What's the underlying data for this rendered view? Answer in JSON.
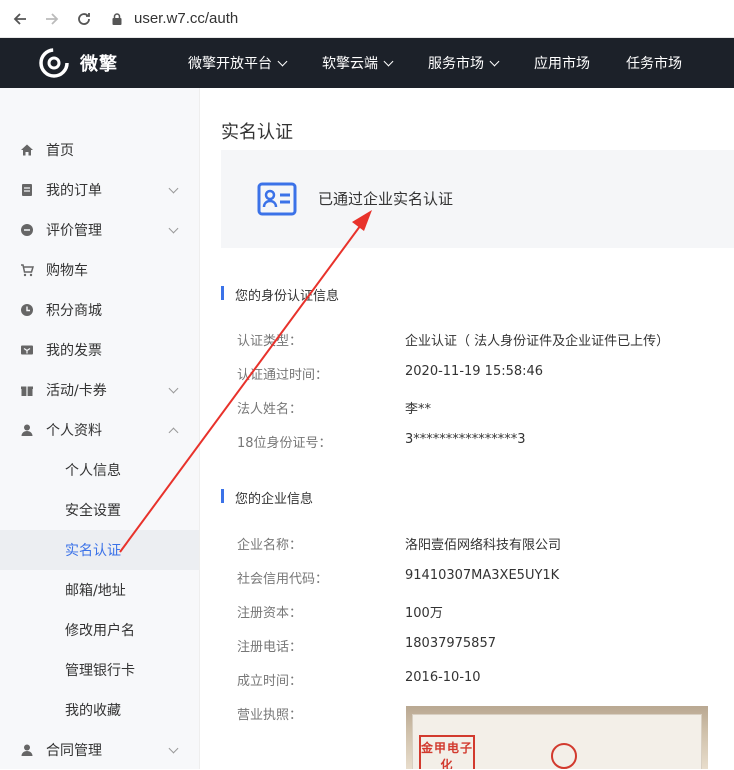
{
  "browser": {
    "url": "user.w7.cc/auth"
  },
  "topnav": {
    "logo_text": "微擎",
    "items": [
      {
        "label": "微擎开放平台",
        "dropdown": true
      },
      {
        "label": "软擎云端",
        "dropdown": true
      },
      {
        "label": "服务市场",
        "dropdown": true
      },
      {
        "label": "应用市场",
        "dropdown": false
      },
      {
        "label": "任务市场",
        "dropdown": false
      }
    ]
  },
  "sidebar": {
    "items": [
      {
        "label": "首页",
        "icon": "home-icon"
      },
      {
        "label": "我的订单",
        "icon": "order-icon",
        "expandable": true
      },
      {
        "label": "评价管理",
        "icon": "review-icon",
        "expandable": true
      },
      {
        "label": "购物车",
        "icon": "cart-icon"
      },
      {
        "label": "积分商城",
        "icon": "points-icon"
      },
      {
        "label": "我的发票",
        "icon": "invoice-icon"
      },
      {
        "label": "活动/卡券",
        "icon": "gift-icon",
        "expandable": true
      },
      {
        "label": "个人资料",
        "icon": "user-icon",
        "expanded": true
      }
    ],
    "sub_items": [
      {
        "label": "个人信息"
      },
      {
        "label": "安全设置"
      },
      {
        "label": "实名认证",
        "active": true
      },
      {
        "label": "邮箱/地址"
      },
      {
        "label": "修改用户名"
      },
      {
        "label": "管理银行卡"
      },
      {
        "label": "我的收藏"
      }
    ],
    "bottom_item": {
      "label": "合同管理",
      "icon": "contract-icon"
    }
  },
  "main": {
    "title": "实名认证",
    "status": "已通过企业实名认证",
    "identity_section": {
      "title": "您的身份认证信息",
      "rows": [
        {
          "label": "认证类型：",
          "value": "企业认证（ 法人身份证件及企业证件已上传）"
        },
        {
          "label": "认证通过时间：",
          "value": "2020-11-19 15:58:46"
        },
        {
          "label": "法人姓名：",
          "value": "李**"
        },
        {
          "label": "18位身份证号：",
          "value": "3****************3"
        }
      ]
    },
    "company_section": {
      "title": "您的企业信息",
      "rows": [
        {
          "label": "企业名称：",
          "value": "洛阳壹佰网络科技有限公司"
        },
        {
          "label": "社会信用代码：",
          "value": "91410307MA3XE5UY1K"
        },
        {
          "label": "注册资本：",
          "value": "100万"
        },
        {
          "label": "注册电话：",
          "value": "18037975857"
        },
        {
          "label": "成立时间：",
          "value": "2016-10-10"
        },
        {
          "label": "营业执照：",
          "value": ""
        }
      ]
    },
    "license_stamp_text": "金甲电子化"
  },
  "colors": {
    "accent": "#3b72e8",
    "topnav_bg": "#1c2129",
    "annotation": "#e8322b"
  }
}
